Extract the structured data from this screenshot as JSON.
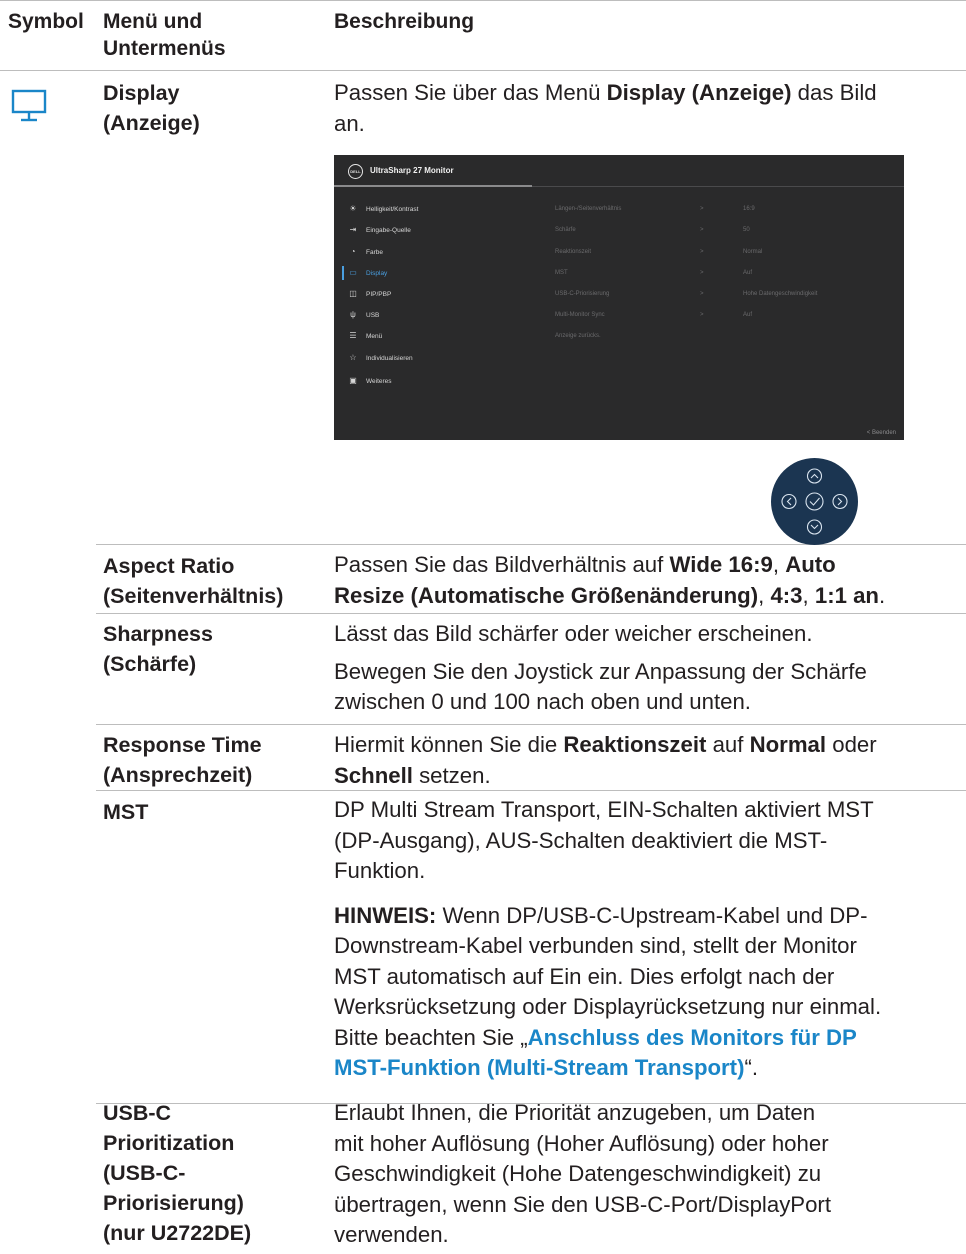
{
  "header": {
    "symbol": "Symbol",
    "menu_line1": "Menü und",
    "menu_line2": "Untermenüs",
    "description": "Beschreibung"
  },
  "display_row": {
    "icon": "monitor-icon",
    "name_line1": "Display",
    "name_line2": "(Anzeige)",
    "desc_pre": "Passen Sie über das Menü ",
    "desc_bold": "Display (Anzeige)",
    "desc_post": " das Bild",
    "desc_line2": "an."
  },
  "osd": {
    "logo": "DELL",
    "title": "UltraSharp 27 Monitor",
    "menu": [
      {
        "icon": "brightness-icon",
        "label": "Helligkeit/Kontrast"
      },
      {
        "icon": "input-source-icon",
        "label": "Eingabe-Quelle"
      },
      {
        "icon": "color-icon",
        "label": "Farbe"
      },
      {
        "icon": "display-icon",
        "label": "Display",
        "active": true
      },
      {
        "icon": "pip-pbp-icon",
        "label": "PIP/PBP"
      },
      {
        "icon": "usb-icon",
        "label": "USB"
      },
      {
        "icon": "menu-icon",
        "label": "Menü"
      },
      {
        "icon": "star-icon",
        "label": "Individualisieren"
      },
      {
        "icon": "others-icon",
        "label": "Weiteres"
      }
    ],
    "submenu": [
      {
        "label": "Längen-/Seitenverhältnis",
        "arrow": ">",
        "value": "16:9"
      },
      {
        "label": "Schärfe",
        "arrow": ">",
        "value": "50"
      },
      {
        "label": "Reaktionszeit",
        "arrow": ">",
        "value": "Normal"
      },
      {
        "label": "MST",
        "arrow": ">",
        "value": "Auf"
      },
      {
        "label": "USB-C-Priorisierung",
        "arrow": ">",
        "value": "Hohe Datengeschwindigkeit"
      },
      {
        "label": "Multi-Monitor Sync",
        "arrow": ">",
        "value": "Auf"
      },
      {
        "label": "Anzeige zurücks.",
        "arrow": "",
        "value": ""
      }
    ],
    "exit": "<  Beenden"
  },
  "joystick": {
    "icon": "joystick-icon"
  },
  "rows": {
    "aspect": {
      "name_line1": "Aspect Ratio",
      "name_line2": "(Seitenverhältnis)",
      "t1": "Passen Sie das Bildverhältnis auf ",
      "b1": "Wide 16:9",
      "t2": ", ",
      "b2": "Auto",
      "b3": "Resize (Automatische Größenänderung)",
      "t3": ", ",
      "b4": "4:3",
      "t4": ", ",
      "b5": "1:1 an",
      "t5": "."
    },
    "sharpness": {
      "name_line1": "Sharpness",
      "name_line2": "(Schärfe)",
      "line1": "Lässt das Bild schärfer oder weicher erscheinen.",
      "line2": "Bewegen Sie den Joystick zur Anpassung der Schärfe",
      "line3": "zwischen 0 und 100 nach oben und unten."
    },
    "response": {
      "name_line1": "Response Time",
      "name_line2": "(Ansprechzeit)",
      "t1": "Hiermit können Sie die ",
      "b1": "Reaktionszeit",
      "t2": " auf ",
      "b2": "Normal",
      "t3": " oder",
      "b3": "Schnell",
      "t4": " setzen."
    },
    "mst": {
      "name": "MST",
      "line1": "DP Multi Stream Transport,  EIN-Schalten aktiviert MST",
      "line2": "(DP-Ausgang), AUS-Schalten deaktiviert die MST-",
      "line3": "Funktion.",
      "note_label": "HINWEIS:",
      "note1": " Wenn DP/USB-C-Upstream-Kabel und DP-",
      "note2": "Downstream-Kabel verbunden sind, stellt der Monitor",
      "note3": "MST automatisch auf Ein ein. Dies erfolgt nach der",
      "note4": "Werksrücksetzung oder Displayrücksetzung nur einmal.",
      "note5_pre": "Bitte beachten Sie „",
      "link1": "Anschluss des Monitors für DP",
      "link2": "MST-Funktion (Multi-Stream Transport)",
      "note6_post": "“."
    },
    "usbc": {
      "name_line1": "USB-C",
      "name_line2": "Prioritization",
      "name_line3": "(USB-C-",
      "name_line4": "Priorisierung)",
      "name_line5": "(nur U2722DE)",
      "line1": "Erlaubt Ihnen, die Priorität anzugeben, um Daten",
      "line2": "mit hoher Auflösung (Hoher Auflösung) oder hoher",
      "line3": "Geschwindigkeit (Hohe Datengeschwindigkeit) zu",
      "line4": "übertragen, wenn Sie den USB-C-Port/DisplayPort",
      "line5": "verwenden."
    }
  }
}
